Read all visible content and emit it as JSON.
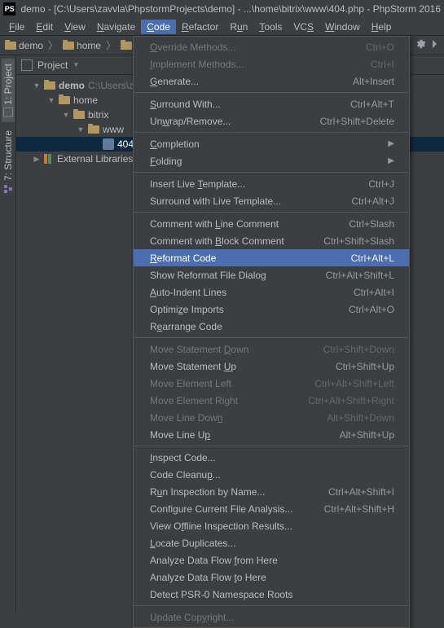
{
  "titlebar": {
    "ps": "PS",
    "text": "demo - [C:\\Users\\zavvla\\PhpstormProjects\\demo] - ...\\home\\bitrix\\www\\404.php - PhpStorm 2016"
  },
  "menubar": {
    "file": "File",
    "edit": "Edit",
    "view": "View",
    "navigate": "Navigate",
    "code": "Code",
    "refactor": "Refactor",
    "run": "Run",
    "tools": "Tools",
    "vcs": "VCS",
    "window": "Window",
    "help": "Help"
  },
  "breadcrumbs": {
    "demo": "demo",
    "home": "home",
    "b": "b"
  },
  "side": {
    "project": "1: Project",
    "structure": "7: Structure"
  },
  "panel": {
    "title": "Project"
  },
  "tree": {
    "demo": "demo",
    "demo_path": "C:\\Users\\za",
    "home": "home",
    "bitrix": "bitrix",
    "www": "www",
    "file": "404",
    "ext": "External Libraries"
  },
  "menu": {
    "override": {
      "label": "Override Methods...",
      "sc": "Ctrl+O"
    },
    "implement": {
      "label": "Implement Methods...",
      "sc": "Ctrl+I"
    },
    "generate": {
      "label": "Generate...",
      "sc": "Alt+Insert"
    },
    "surround": {
      "label": "Surround With...",
      "sc": "Ctrl+Alt+T"
    },
    "unwrap": {
      "label": "Unwrap/Remove...",
      "sc": "Ctrl+Shift+Delete"
    },
    "completion": {
      "label": "Completion"
    },
    "folding": {
      "label": "Folding"
    },
    "insert_tmpl": {
      "label": "Insert Live Template...",
      "sc": "Ctrl+J"
    },
    "surround_tmpl": {
      "label": "Surround with Live Template...",
      "sc": "Ctrl+Alt+J"
    },
    "line_comment": {
      "label": "Comment with Line Comment",
      "sc": "Ctrl+Slash"
    },
    "block_comment": {
      "label": "Comment with Block Comment",
      "sc": "Ctrl+Shift+Slash"
    },
    "reformat": {
      "label": "Reformat Code",
      "sc": "Ctrl+Alt+L"
    },
    "reformat_dlg": {
      "label": "Show Reformat File Dialog",
      "sc": "Ctrl+Alt+Shift+L"
    },
    "autoindent": {
      "label": "Auto-Indent Lines",
      "sc": "Ctrl+Alt+I"
    },
    "optimize": {
      "label": "Optimize Imports",
      "sc": "Ctrl+Alt+O"
    },
    "rearrange": {
      "label": "Rearrange Code"
    },
    "move_stmt_down": {
      "label": "Move Statement Down",
      "sc": "Ctrl+Shift+Down"
    },
    "move_stmt_up": {
      "label": "Move Statement Up",
      "sc": "Ctrl+Shift+Up"
    },
    "move_el_left": {
      "label": "Move Element Left",
      "sc": "Ctrl+Alt+Shift+Left"
    },
    "move_el_right": {
      "label": "Move Element Right",
      "sc": "Ctrl+Alt+Shift+Right"
    },
    "move_line_down": {
      "label": "Move Line Down",
      "sc": "Alt+Shift+Down"
    },
    "move_line_up": {
      "label": "Move Line Up",
      "sc": "Alt+Shift+Up"
    },
    "inspect": {
      "label": "Inspect Code..."
    },
    "cleanup": {
      "label": "Code Cleanup..."
    },
    "run_insp": {
      "label": "Run Inspection by Name...",
      "sc": "Ctrl+Alt+Shift+I"
    },
    "conf_analysis": {
      "label": "Configure Current File Analysis...",
      "sc": "Ctrl+Alt+Shift+H"
    },
    "offline": {
      "label": "View Offline Inspection Results..."
    },
    "dupes": {
      "label": "Locate Duplicates..."
    },
    "flow_from": {
      "label": "Analyze Data Flow from Here"
    },
    "flow_to": {
      "label": "Analyze Data Flow to Here"
    },
    "psr0": {
      "label": "Detect PSR-0 Namespace Roots"
    },
    "copyright": {
      "label": "Update Copyright..."
    }
  }
}
